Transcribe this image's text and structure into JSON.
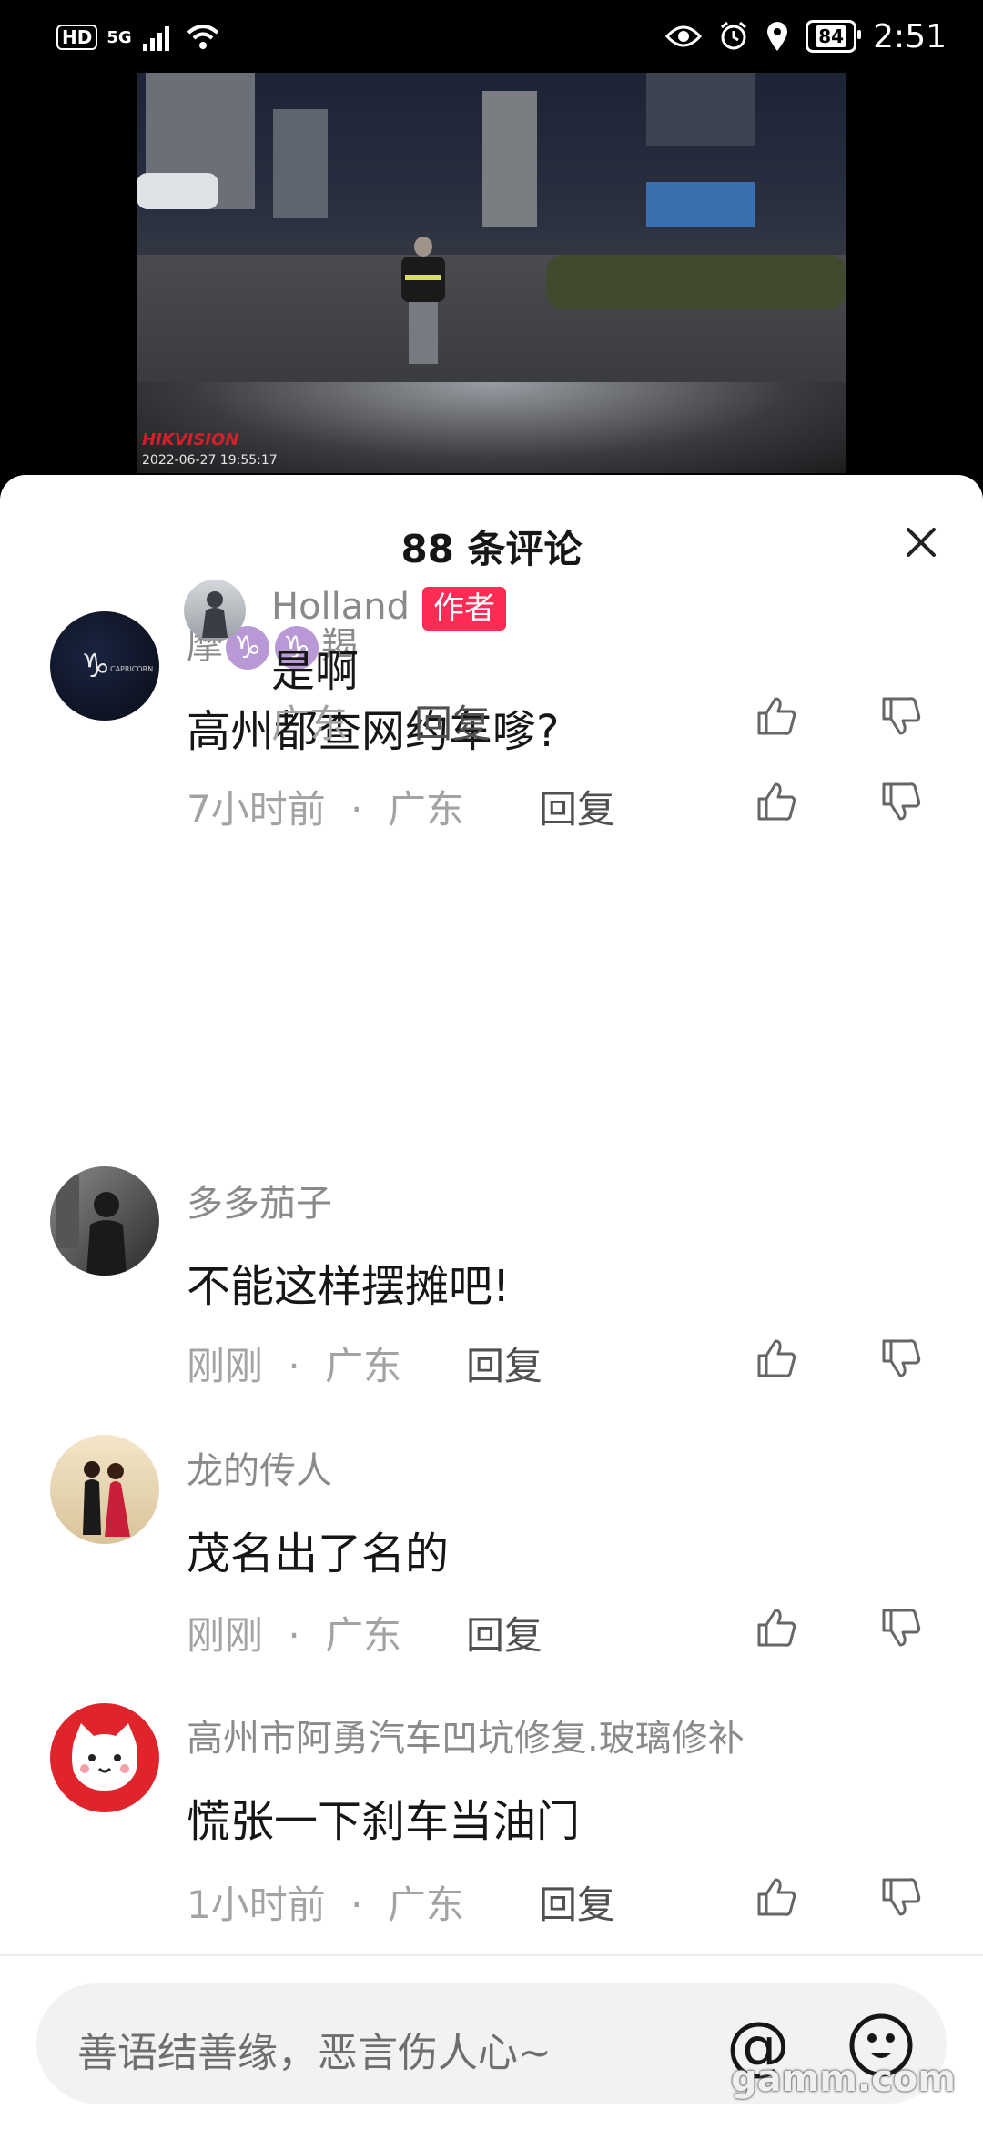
{
  "status_bar": {
    "hd": "HD",
    "network": "5G",
    "battery": "84",
    "time": "2:51"
  },
  "video": {
    "brand": "HIKVISION",
    "timestamp": "2022-06-27   19:55:17"
  },
  "sheet": {
    "title": "88 条评论"
  },
  "comments": [
    {
      "name_prefix": "摩",
      "zodiac1": "♑",
      "zodiac2": "♑",
      "name_suffix": "羯",
      "text": "高州都查网约车嗲?",
      "time": "7小时前",
      "sep": "·",
      "location": "广东",
      "reply": "回复"
    },
    {
      "name": "Holland",
      "badge": "作者",
      "text": "是啊",
      "location": "广东",
      "reply": "回复"
    },
    {
      "name": "多多茄子",
      "text": "不能这样摆摊吧!",
      "time": "刚刚",
      "sep": "·",
      "location": "广东",
      "reply": "回复"
    },
    {
      "name": "龙的传人",
      "text": "茂名出了名的",
      "time": "刚刚",
      "sep": "·",
      "location": "广东",
      "reply": "回复"
    },
    {
      "name": "高州市阿勇汽车凹坑修复.玻璃修补",
      "text": "慌张一下刹车当油门",
      "time": "1小时前",
      "sep": "·",
      "location": "广东",
      "reply": "回复"
    }
  ],
  "input": {
    "placeholder": "善语结善缘，恶言伤人心~",
    "at_symbol": "@"
  },
  "watermark": "gamm.com",
  "colors": {
    "author_badge": "#fe2c55",
    "zodiac": "#b899d6"
  }
}
